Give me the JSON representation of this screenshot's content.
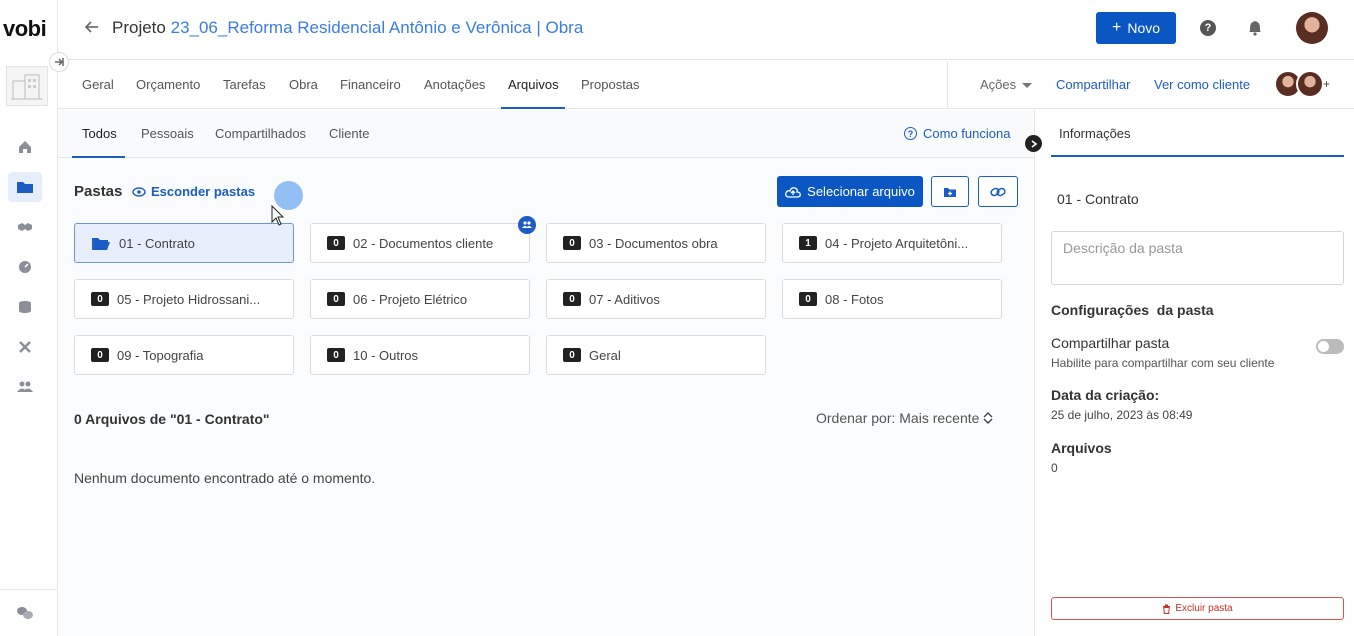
{
  "brand": "vobi",
  "header": {
    "prefix": "Projeto",
    "project_name": "23_06_Reforma Residencial Antônio e Verônica | Obra",
    "new_button": "Novo"
  },
  "main_tabs": [
    "Geral",
    "Orçamento",
    "Tarefas",
    "Obra",
    "Financeiro",
    "Anotações",
    "Arquivos",
    "Propostas"
  ],
  "active_main_tab": "Arquivos",
  "tab_actions": {
    "acoes": "Ações",
    "compartilhar": "Compartilhar",
    "ver_como_cliente": "Ver como cliente",
    "more": "+"
  },
  "sub_tabs": [
    "Todos",
    "Pessoais",
    "Compartilhados",
    "Cliente"
  ],
  "active_sub_tab": "Todos",
  "como_funciona": "Como funciona",
  "pastas": {
    "label": "Pastas",
    "toggle": "Esconder pastas",
    "select_button": "Selecionar arquivo"
  },
  "folders": [
    {
      "name": "01 - Contrato",
      "count": "",
      "selected": true
    },
    {
      "name": "02 - Documentos cliente",
      "count": "0",
      "shared": true
    },
    {
      "name": "03 - Documentos obra",
      "count": "0"
    },
    {
      "name": "04 - Projeto Arquitetôni...",
      "count": "1"
    },
    {
      "name": "05 - Projeto Hidrossani...",
      "count": "0"
    },
    {
      "name": "06 - Projeto Elétrico",
      "count": "0"
    },
    {
      "name": "07 - Aditivos",
      "count": "0"
    },
    {
      "name": "08 - Fotos",
      "count": "0"
    },
    {
      "name": "09 - Topografia",
      "count": "0"
    },
    {
      "name": "10 - Outros",
      "count": "0"
    },
    {
      "name": "Geral",
      "count": "0"
    }
  ],
  "files": {
    "count_label": "0 Arquivos de \"01 - Contrato\"",
    "sort_label": "Ordenar por: Mais recente",
    "empty_message": "Nenhum documento encontrado até o momento."
  },
  "panel": {
    "tab": "Informações",
    "folder_name": "01 - Contrato",
    "description_placeholder": "Descrição da pasta",
    "config_heading": "Configurações  da pasta",
    "share_label": "Compartilhar pasta",
    "share_sub": "Habilite para compartilhar com seu cliente",
    "share_enabled": false,
    "created_label": "Data da criação:",
    "created_value": "25 de julho, 2023 às 08:49",
    "files_label": "Arquivos",
    "files_value": "0",
    "delete_button": "Excluir pasta"
  },
  "colors": {
    "primary": "#0a56c2",
    "link": "#1c5cc4",
    "danger": "#c9302c"
  }
}
